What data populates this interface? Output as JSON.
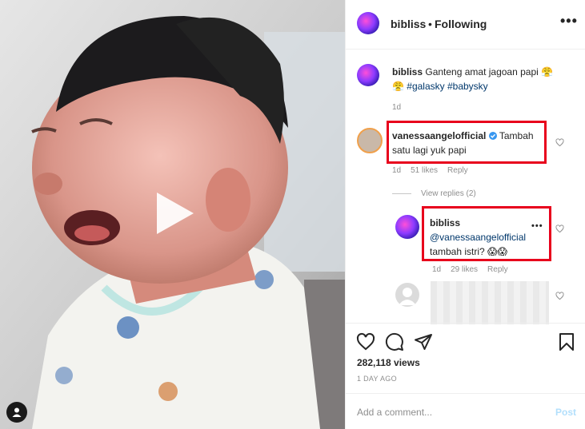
{
  "header": {
    "username": "bibliss",
    "dot": "•",
    "follow_status": "Following",
    "more": "•••"
  },
  "caption": {
    "username": "bibliss",
    "text_line1": "Ganteng amat jagoan papi 😤",
    "text_line2_prefix": "😤 ",
    "hashtags": "#galasky #babysky",
    "time": "1d"
  },
  "comments": [
    {
      "username": "vanessaangelofficial",
      "verified": true,
      "text_line1": "Tambah",
      "text_line2": "satu lagi yuk papi",
      "time": "1d",
      "likes": "51 likes",
      "reply": "Reply",
      "view_replies": "View replies (2)"
    },
    {
      "username": "bibliss",
      "mention": "@vanessaangelofficial",
      "text_line2": "tambah istri? 😱😱",
      "time": "1d",
      "likes": "29 likes",
      "reply": "Reply",
      "more": "•••"
    }
  ],
  "stats": {
    "views": "282,118 views",
    "posted": "1 DAY AGO"
  },
  "add_comment": {
    "placeholder": "Add a comment...",
    "post_label": "Post"
  },
  "colors": {
    "highlight_box": "#e8001c",
    "verified": "#3897f0",
    "link": "#00376b"
  },
  "icons": [
    "play-icon",
    "user-tag-icon",
    "heart-icon",
    "comment-icon",
    "share-icon",
    "bookmark-icon",
    "verified-icon"
  ]
}
